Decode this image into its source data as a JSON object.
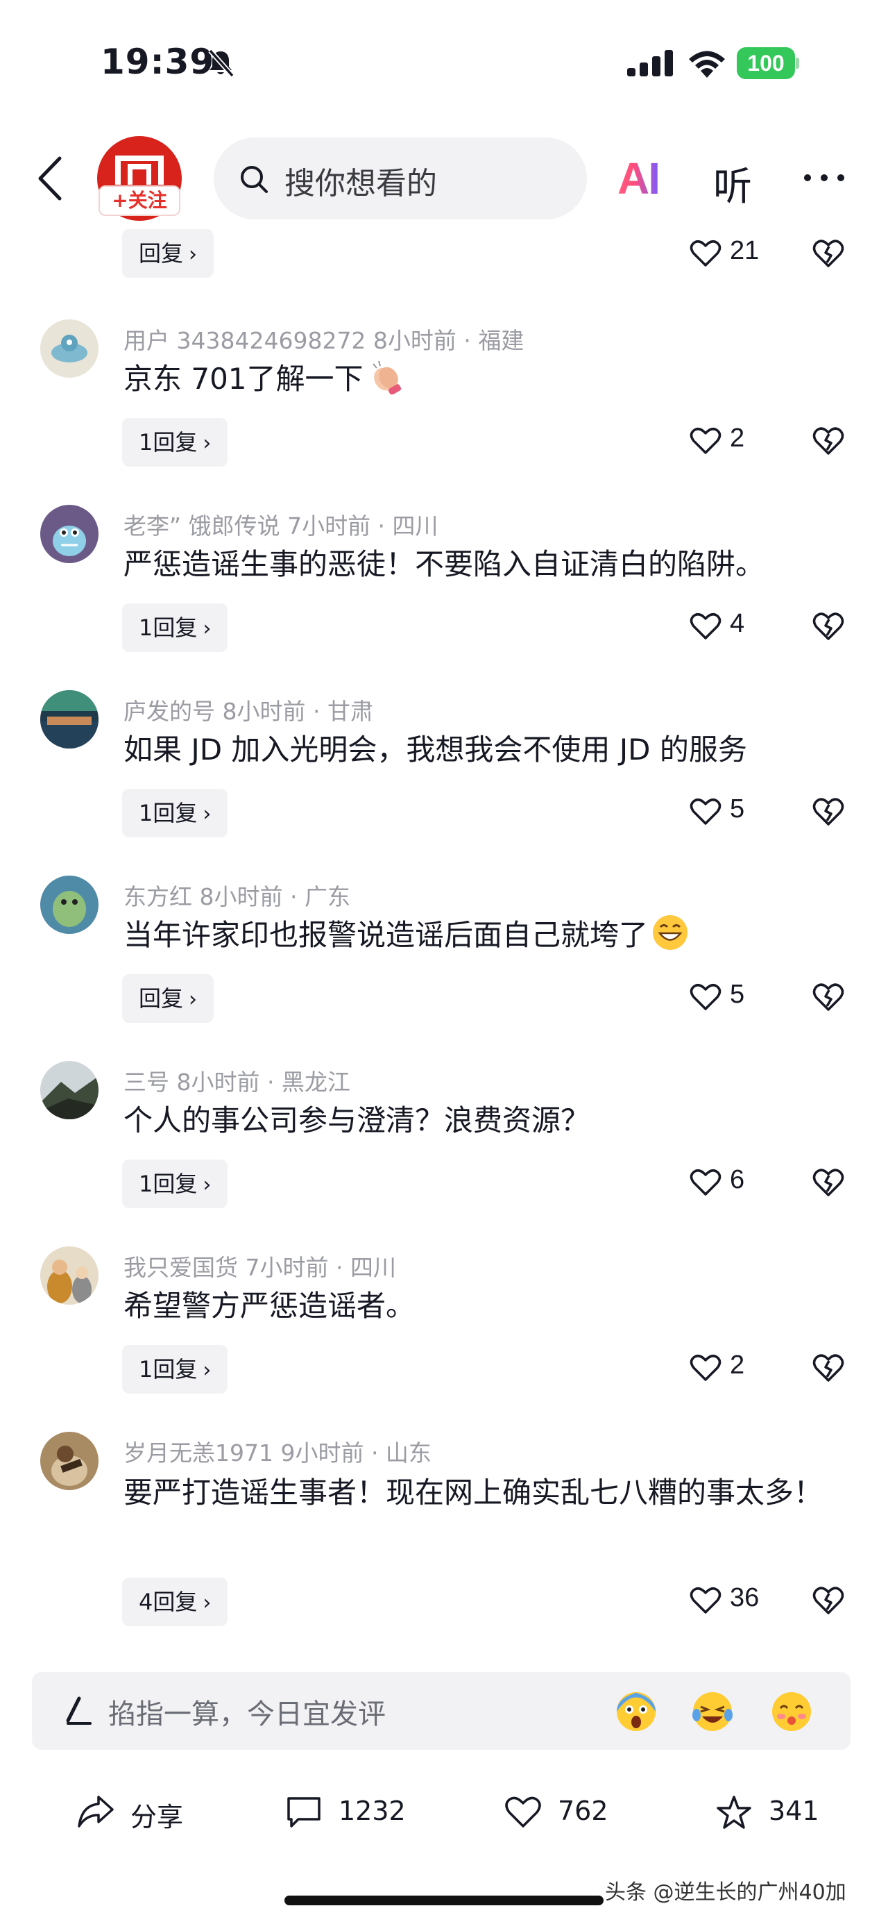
{
  "status_bar": {
    "time": "19:39",
    "battery": "100"
  },
  "nav": {
    "follow_label": "+关注",
    "search_placeholder": "搜你想看的",
    "ai_label": "AI",
    "listen_label": "听"
  },
  "comments": [
    {
      "meta": "",
      "text": "",
      "reply": "回复",
      "likes": "21"
    },
    {
      "meta": "用户 3438424698272  8小时前 · 福建",
      "text": "京东 701了解一下",
      "reply": "1回复",
      "likes": "2"
    },
    {
      "meta": "老李” 饿郎传说  7小时前 · 四川",
      "text": "严惩造谣生事的恶徒！不要陷入自证清白的陷阱。",
      "reply": "1回复",
      "likes": "4"
    },
    {
      "meta": "庐发的号  8小时前 · 甘肃",
      "text": "如果 JD 加入光明会，我想我会不使用 JD 的服务",
      "reply": "1回复",
      "likes": "5"
    },
    {
      "meta": "东方红  8小时前 · 广东",
      "text": "当年许家印也报警说造谣后面自己就垮了",
      "reply": "回复",
      "likes": "5"
    },
    {
      "meta": "三号  8小时前 · 黑龙江",
      "text": "个人的事公司参与澄清？浪费资源？",
      "reply": "1回复",
      "likes": "6"
    },
    {
      "meta": "我只爱国货  7小时前 · 四川",
      "text": "希望警方严惩造谣者。",
      "reply": "1回复",
      "likes": "2"
    },
    {
      "meta": "岁月无恙1971  9小时前 · 山东",
      "text": "要严打造谣生事者！现在网上确实乱七八糟的事太多！",
      "reply": "4回复",
      "likes": "36"
    }
  ],
  "composer": {
    "placeholder": "掐指一算，今日宜发评"
  },
  "bottom_bar": {
    "share_label": "分享",
    "comments_count": "1232",
    "likes_count": "762",
    "favorites_count": "341"
  },
  "watermark": "头条 @逆生长的广州40加",
  "icons": [
    "back-icon",
    "search-icon",
    "more-icon",
    "heart-icon",
    "dislike-icon",
    "pen-icon",
    "share-icon",
    "comment-icon",
    "star-icon",
    "bell-off-icon",
    "wifi-icon",
    "signal-icon"
  ],
  "colors": {
    "accent_red": "#e5302b",
    "battery_green": "#34c759",
    "meta_gray": "#9b9ca3",
    "chip_bg": "#f2f2f4"
  }
}
